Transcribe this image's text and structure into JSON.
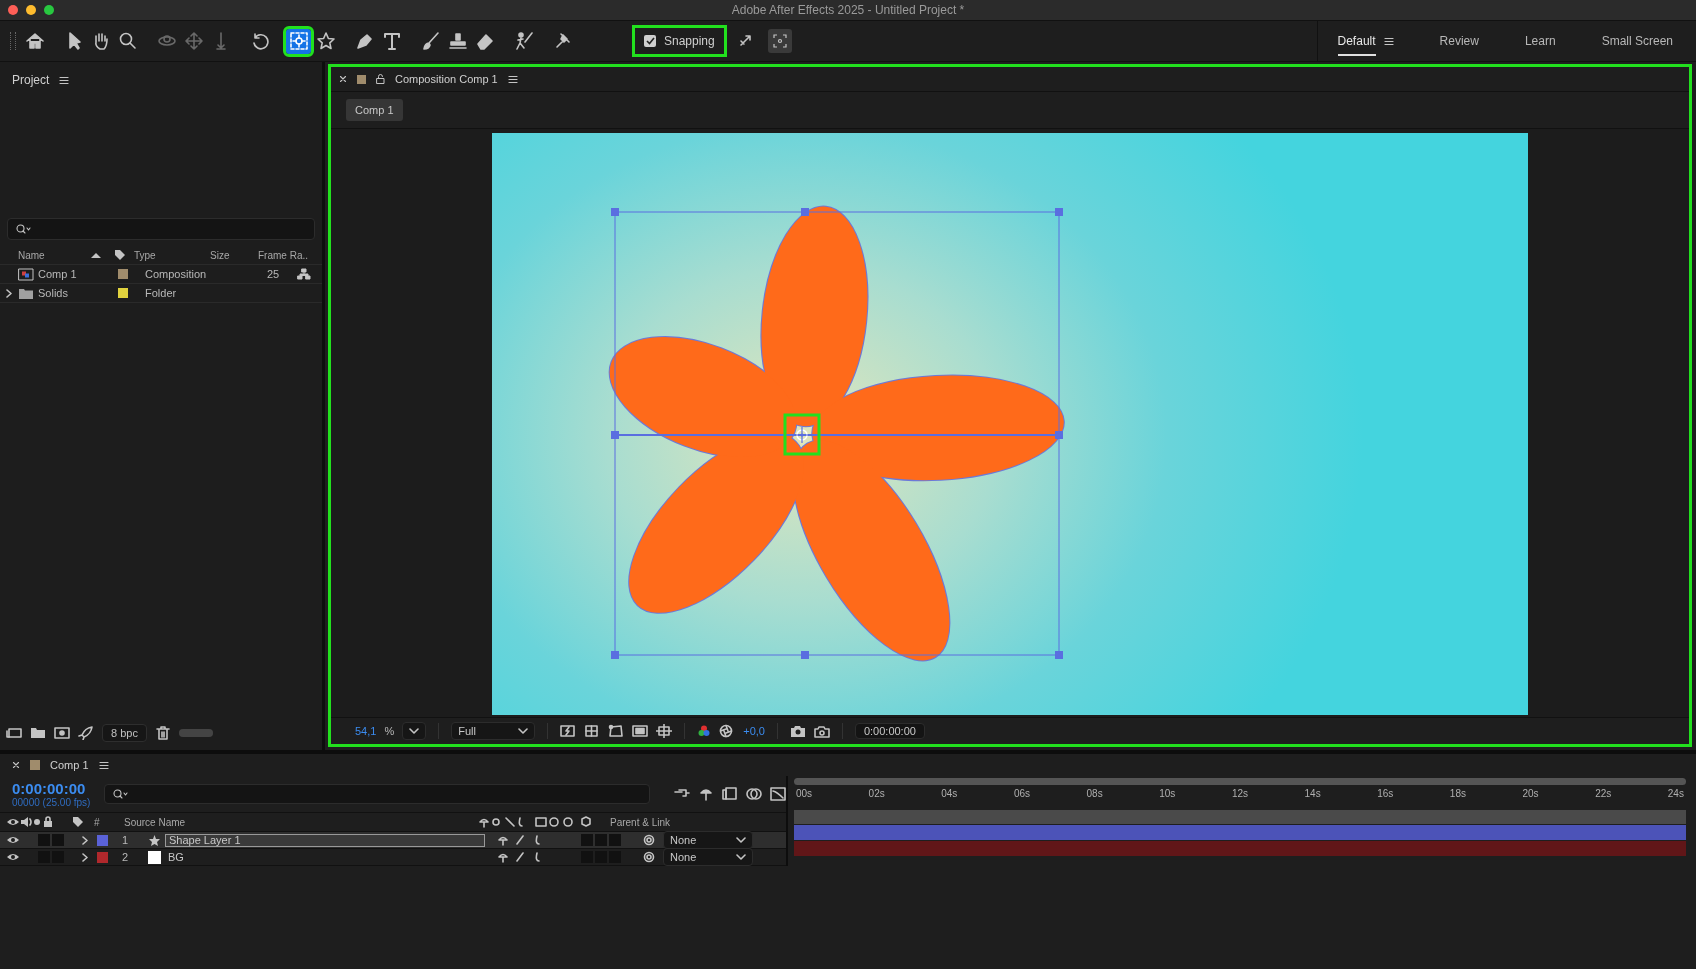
{
  "window": {
    "title": "Adobe After Effects 2025 - Untitled Project *"
  },
  "toolbar": {
    "tools": [
      {
        "kind": "home",
        "selected": false,
        "disabled": false,
        "highlighted": false
      },
      {
        "kind": "selection",
        "selected": false,
        "disabled": false,
        "highlighted": false
      },
      {
        "kind": "hand",
        "selected": false,
        "disabled": false,
        "highlighted": false
      },
      {
        "kind": "zoom",
        "selected": false,
        "disabled": false,
        "highlighted": false
      },
      {
        "kind": "orbit",
        "selected": false,
        "disabled": true,
        "highlighted": false
      },
      {
        "kind": "pan",
        "selected": false,
        "disabled": true,
        "highlighted": false
      },
      {
        "kind": "dolly",
        "selected": false,
        "disabled": true,
        "highlighted": false
      },
      {
        "kind": "rotate",
        "selected": false,
        "disabled": false,
        "highlighted": false
      },
      {
        "kind": "pan_behind",
        "selected": true,
        "disabled": false,
        "highlighted": true
      },
      {
        "kind": "star",
        "selected": false,
        "disabled": false,
        "highlighted": false
      },
      {
        "kind": "pen",
        "selected": false,
        "disabled": false,
        "highlighted": false
      },
      {
        "kind": "text",
        "selected": false,
        "disabled": false,
        "highlighted": false
      },
      {
        "kind": "brush",
        "selected": false,
        "disabled": false,
        "highlighted": false
      },
      {
        "kind": "stamp",
        "selected": false,
        "disabled": false,
        "highlighted": false
      },
      {
        "kind": "eraser",
        "selected": false,
        "disabled": false,
        "highlighted": false
      },
      {
        "kind": "roto",
        "selected": false,
        "disabled": false,
        "highlighted": false
      },
      {
        "kind": "puppet",
        "selected": false,
        "disabled": false,
        "highlighted": false
      }
    ],
    "snapping": {
      "label": "Snapping",
      "checked": true,
      "highlighted": true
    },
    "workspaces": [
      {
        "label": "Default",
        "selected": true
      },
      {
        "label": "Review",
        "selected": false
      },
      {
        "label": "Learn",
        "selected": false
      },
      {
        "label": "Small Screen",
        "selected": false
      }
    ]
  },
  "project_panel": {
    "title": "Project",
    "columns": [
      "Name",
      "Type",
      "Size",
      "Frame Ra.."
    ],
    "items": [
      {
        "kind": "composition",
        "name": "Comp 1",
        "color": "#a08c6c",
        "type": "Composition",
        "frame_rate": "25"
      },
      {
        "kind": "folder",
        "name": "Solids",
        "color": "#e0d23e",
        "type": "Folder"
      }
    ],
    "bit_depth": "8 bpc",
    "thumbnail_slider": {
      "level": 1
    }
  },
  "viewer": {
    "tab": "Composition Comp 1",
    "highlighted": true,
    "breadcrumb": "Comp 1",
    "anchor_highlighted": true,
    "zoom": "54,1",
    "zoom_unit": "%",
    "resolution": "Full",
    "exposure": "+0,0",
    "timecode": "0:00:00:00"
  },
  "timeline": {
    "tab": "Comp 1",
    "timecode": "0:00:00:00",
    "frame_info": "00000 (25.00 fps)",
    "headers": {
      "number": "#",
      "source_name": "Source Name",
      "parent": "Parent & Link"
    },
    "layers": [
      {
        "kind": "shape",
        "number": "1",
        "name": "Shape Layer 1",
        "color": "#5a62d8",
        "selected": true,
        "parent": "None"
      },
      {
        "kind": "solid",
        "number": "2",
        "name": "BG",
        "color": "#b0282c",
        "selected": false,
        "parent": "None"
      }
    ],
    "ruler": [
      "00s",
      "02s",
      "04s",
      "06s",
      "08s",
      "10s",
      "12s",
      "14s",
      "16s",
      "18s",
      "20s",
      "22s",
      "24s"
    ]
  }
}
